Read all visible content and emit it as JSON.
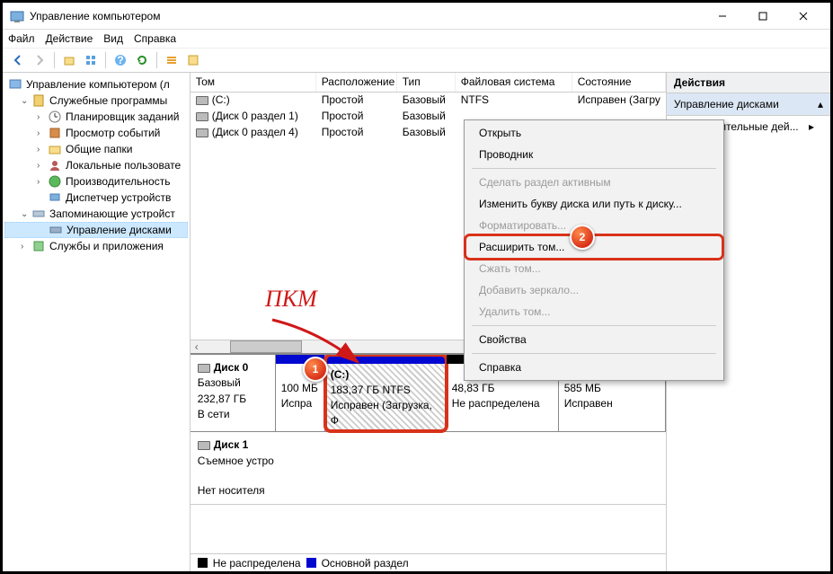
{
  "window": {
    "title": "Управление компьютером"
  },
  "menu": {
    "file": "Файл",
    "action": "Действие",
    "view": "Вид",
    "help": "Справка"
  },
  "tree": {
    "root": "Управление компьютером (л",
    "services_group": "Служебные программы",
    "scheduler": "Планировщик заданий",
    "eventviewer": "Просмотр событий",
    "sharedfolders": "Общие папки",
    "localusers": "Локальные пользовате",
    "performance": "Производительность",
    "devicemgr": "Диспетчер устройств",
    "storage_group": "Запоминающие устройст",
    "diskmgmt": "Управление дисками",
    "apps": "Службы и приложения"
  },
  "vol_headers": {
    "vol": "Том",
    "loc": "Расположение",
    "type": "Тип",
    "fs": "Файловая система",
    "state": "Состояние"
  },
  "volumes": [
    {
      "name": "(C:)",
      "loc": "Простой",
      "type": "Базовый",
      "fs": "NTFS",
      "state": "Исправен (Загру"
    },
    {
      "name": "(Диск 0 раздел 1)",
      "loc": "Простой",
      "type": "Базовый",
      "fs": "",
      "state": ""
    },
    {
      "name": "(Диск 0 раздел 4)",
      "loc": "Простой",
      "type": "Базовый",
      "fs": "",
      "state": ""
    }
  ],
  "disks": {
    "d0": {
      "title": "Диск 0",
      "type": "Базовый",
      "size": "232,87 ГБ",
      "status": "В сети"
    },
    "p0": {
      "size": "100 МБ",
      "status": "Испра"
    },
    "p1": {
      "name": "(C:)",
      "size": "183,37 ГБ NTFS",
      "status": "Исправен (Загрузка, Ф"
    },
    "p2": {
      "size": "48,83 ГБ",
      "status": "Не распределена"
    },
    "p3": {
      "size": "585 МБ",
      "status": "Исправен"
    },
    "d1": {
      "title": "Диск 1",
      "type": "Съемное устро",
      "status": "Нет носителя"
    }
  },
  "legend": {
    "unalloc": "Не распределена",
    "primary": "Основной раздел"
  },
  "actions": {
    "header": "Действия",
    "diskmgmt": "Управление дисками",
    "more": "Дополнительные дей..."
  },
  "ctx": {
    "open": "Открыть",
    "explorer": "Проводник",
    "active": "Сделать раздел активным",
    "changeletter": "Изменить букву диска или путь к диску...",
    "format": "Форматировать...",
    "extend": "Расширить том...",
    "shrink": "Сжать том...",
    "mirror": "Добавить зеркало...",
    "delete": "Удалить том...",
    "props": "Свойства",
    "help": "Справка"
  },
  "annot": {
    "pkm": "ПКМ",
    "b1": "1",
    "b2": "2"
  }
}
